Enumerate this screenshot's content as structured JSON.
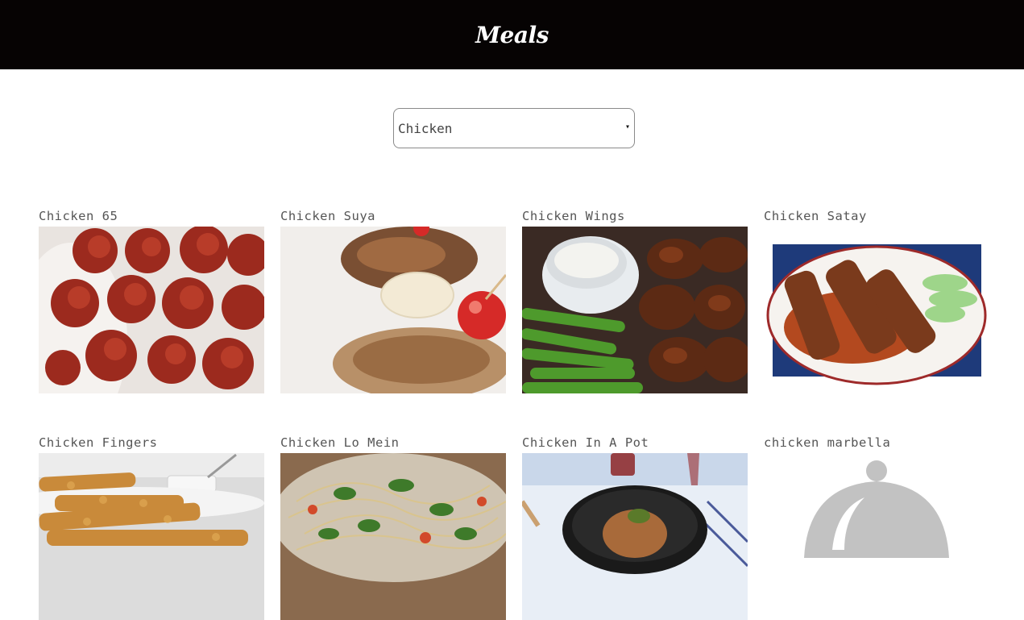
{
  "header": {
    "title": "Meals"
  },
  "filter": {
    "selected": "Chicken",
    "arrow": "▾"
  },
  "meals": [
    {
      "name": "Chicken 65"
    },
    {
      "name": "Chicken Suya"
    },
    {
      "name": "Chicken Wings"
    },
    {
      "name": "Chicken Satay"
    },
    {
      "name": "Chicken Fingers"
    },
    {
      "name": "Chicken Lo Mein"
    },
    {
      "name": "Chicken In A Pot"
    },
    {
      "name": "chicken marbella"
    }
  ],
  "colors": {
    "header_bg": "#060303",
    "header_text": "#ffffff",
    "title_text": "#555555"
  }
}
